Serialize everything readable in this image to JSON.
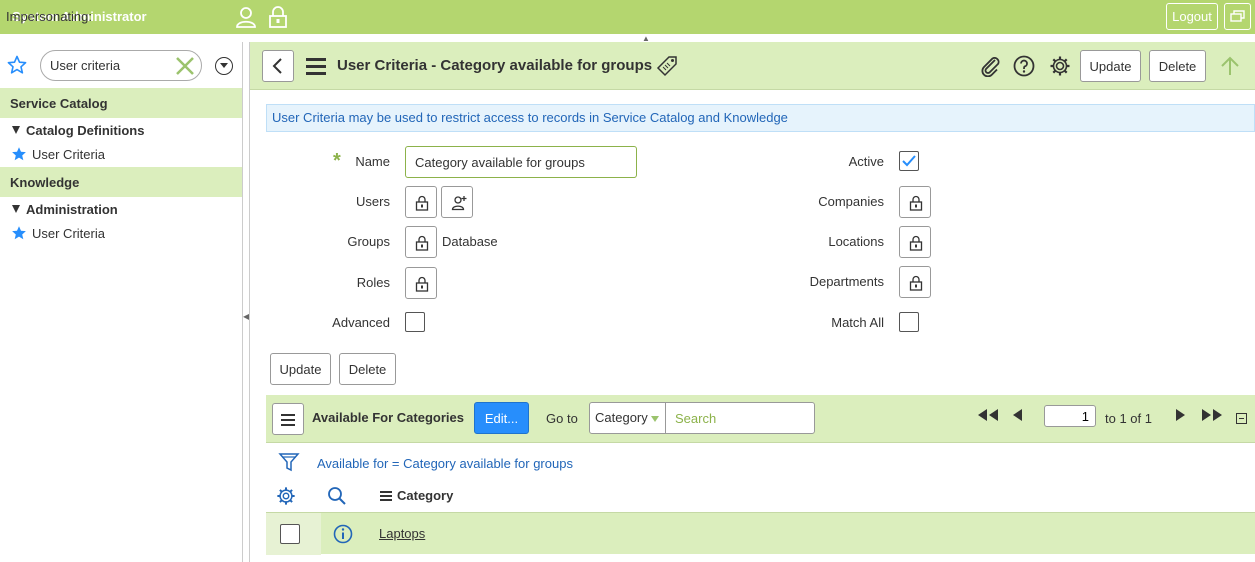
{
  "banner": {
    "impersonating_label": "Impersonating:",
    "user_name": "System Administrator",
    "logout_label": "Logout"
  },
  "nav": {
    "filter_value": "User criteria",
    "sections": [
      {
        "app": "Service Catalog",
        "module_group": "Catalog Definitions",
        "module": "User Criteria"
      },
      {
        "app": "Knowledge",
        "module_group": "Administration",
        "module": "User Criteria"
      }
    ]
  },
  "form": {
    "title": "User Criteria - Category available for groups",
    "update_label": "Update",
    "delete_label": "Delete",
    "info_message": "User Criteria may be used to restrict access to records in Service Catalog and Knowledge",
    "fields": {
      "name_label": "Name",
      "name_value": "Category available for groups",
      "users_label": "Users",
      "groups_label": "Groups",
      "groups_value": "Database",
      "roles_label": "Roles",
      "advanced_label": "Advanced",
      "active_label": "Active",
      "companies_label": "Companies",
      "locations_label": "Locations",
      "departments_label": "Departments",
      "match_all_label": "Match All"
    },
    "active_checked": true
  },
  "related_list": {
    "title": "Available For Categories",
    "edit_label": "Edit...",
    "goto_label": "Go to",
    "goto_field": "Category",
    "search_placeholder": "Search",
    "page_value": "1",
    "page_total": "to 1 of 1",
    "breadcrumb": "Available for = Category available for groups",
    "column_header": "Category",
    "rows": [
      {
        "category": "Laptops"
      }
    ]
  },
  "colors": {
    "banner": "#b4d66f",
    "header_bg": "#dbeebd",
    "accent": "#8cb24a",
    "link": "#2266b8",
    "primary_button": "#278efc"
  }
}
